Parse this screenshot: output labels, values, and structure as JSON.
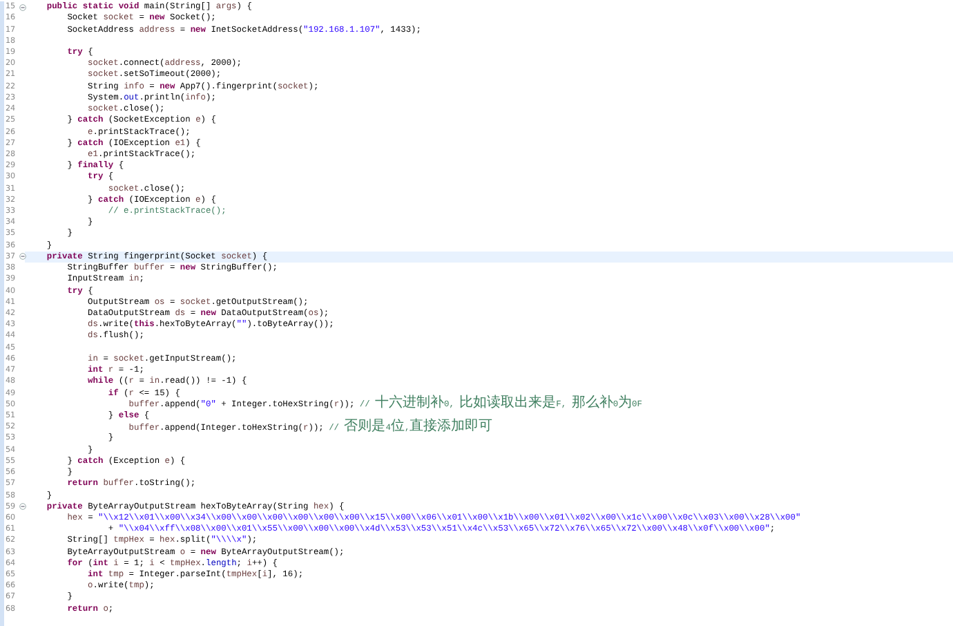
{
  "editor": {
    "lines": [
      {
        "number": "15",
        "fold": true,
        "current": false,
        "tokens": [
          {
            "kind": "keyword",
            "text": "    public static void"
          },
          {
            "kind": "plain",
            "text": " main(String[] "
          },
          {
            "kind": "variable",
            "text": "args"
          },
          {
            "kind": "plain",
            "text": ") {"
          }
        ]
      },
      {
        "number": "16",
        "fold": false,
        "current": false,
        "tokens": [
          {
            "kind": "plain",
            "text": "        Socket "
          },
          {
            "kind": "variable",
            "text": "socket"
          },
          {
            "kind": "plain",
            "text": " = "
          },
          {
            "kind": "keyword",
            "text": "new"
          },
          {
            "kind": "plain",
            "text": " Socket();"
          }
        ]
      },
      {
        "number": "17",
        "fold": false,
        "current": false,
        "tokens": [
          {
            "kind": "plain",
            "text": "        SocketAddress "
          },
          {
            "kind": "variable",
            "text": "address"
          },
          {
            "kind": "plain",
            "text": " = "
          },
          {
            "kind": "keyword",
            "text": "new"
          },
          {
            "kind": "plain",
            "text": " InetSocketAddress("
          },
          {
            "kind": "string",
            "text": "\"192.168.1.107\""
          },
          {
            "kind": "plain",
            "text": ", 1433);"
          }
        ]
      },
      {
        "number": "18",
        "fold": false,
        "current": false
      },
      {
        "number": "19",
        "fold": false,
        "current": false,
        "tokens": [
          {
            "kind": "keyword",
            "text": "        try"
          },
          {
            "kind": "plain",
            "text": " {"
          }
        ]
      },
      {
        "number": "20",
        "fold": false,
        "current": false,
        "tokens": [
          {
            "kind": "variable",
            "text": "            socket"
          },
          {
            "kind": "plain",
            "text": ".connect("
          },
          {
            "kind": "variable",
            "text": "address"
          },
          {
            "kind": "plain",
            "text": ", 2000);"
          }
        ]
      },
      {
        "number": "21",
        "fold": false,
        "current": false,
        "tokens": [
          {
            "kind": "variable",
            "text": "            socket"
          },
          {
            "kind": "plain",
            "text": ".setSoTimeout(2000);"
          }
        ]
      },
      {
        "number": "22",
        "fold": false,
        "current": false,
        "tokens": [
          {
            "kind": "plain",
            "text": "            String "
          },
          {
            "kind": "variable",
            "text": "info"
          },
          {
            "kind": "plain",
            "text": " = "
          },
          {
            "kind": "keyword",
            "text": "new"
          },
          {
            "kind": "plain",
            "text": " App7().fingerprint("
          },
          {
            "kind": "variable",
            "text": "socket"
          },
          {
            "kind": "plain",
            "text": ");"
          }
        ]
      },
      {
        "number": "23",
        "fold": false,
        "current": false,
        "tokens": [
          {
            "kind": "plain",
            "text": "            System."
          },
          {
            "kind": "field",
            "text": "out"
          },
          {
            "kind": "plain",
            "text": ".println("
          },
          {
            "kind": "variable",
            "text": "info"
          },
          {
            "kind": "plain",
            "text": ");"
          }
        ]
      },
      {
        "number": "24",
        "fold": false,
        "current": false,
        "tokens": [
          {
            "kind": "variable",
            "text": "            socket"
          },
          {
            "kind": "plain",
            "text": ".close();"
          }
        ]
      },
      {
        "number": "25",
        "fold": false,
        "current": false,
        "tokens": [
          {
            "kind": "plain",
            "text": "        } "
          },
          {
            "kind": "keyword",
            "text": "catch"
          },
          {
            "kind": "plain",
            "text": " (SocketException "
          },
          {
            "kind": "variable",
            "text": "e"
          },
          {
            "kind": "plain",
            "text": ") {"
          }
        ]
      },
      {
        "number": "26",
        "fold": false,
        "current": false,
        "tokens": [
          {
            "kind": "variable",
            "text": "            e"
          },
          {
            "kind": "plain",
            "text": ".printStackTrace();"
          }
        ]
      },
      {
        "number": "27",
        "fold": false,
        "current": false,
        "tokens": [
          {
            "kind": "plain",
            "text": "        } "
          },
          {
            "kind": "keyword",
            "text": "catch"
          },
          {
            "kind": "plain",
            "text": " (IOException "
          },
          {
            "kind": "variable",
            "text": "e1"
          },
          {
            "kind": "plain",
            "text": ") {"
          }
        ]
      },
      {
        "number": "28",
        "fold": false,
        "current": false,
        "tokens": [
          {
            "kind": "variable",
            "text": "            e1"
          },
          {
            "kind": "plain",
            "text": ".printStackTrace();"
          }
        ]
      },
      {
        "number": "29",
        "fold": false,
        "current": false,
        "tokens": [
          {
            "kind": "plain",
            "text": "        } "
          },
          {
            "kind": "keyword",
            "text": "finally"
          },
          {
            "kind": "plain",
            "text": " {"
          }
        ]
      },
      {
        "number": "30",
        "fold": false,
        "current": false,
        "tokens": [
          {
            "kind": "keyword",
            "text": "            try"
          },
          {
            "kind": "plain",
            "text": " {"
          }
        ]
      },
      {
        "number": "31",
        "fold": false,
        "current": false,
        "tokens": [
          {
            "kind": "variable",
            "text": "                socket"
          },
          {
            "kind": "plain",
            "text": ".close();"
          }
        ]
      },
      {
        "number": "32",
        "fold": false,
        "current": false,
        "tokens": [
          {
            "kind": "plain",
            "text": "            } "
          },
          {
            "kind": "keyword",
            "text": "catch"
          },
          {
            "kind": "plain",
            "text": " (IOException "
          },
          {
            "kind": "variable",
            "text": "e"
          },
          {
            "kind": "plain",
            "text": ") {"
          }
        ]
      },
      {
        "number": "33",
        "fold": false,
        "current": false,
        "tokens": [
          {
            "kind": "comment",
            "text": "                // e.printStackTrace();"
          }
        ]
      },
      {
        "number": "34",
        "fold": false,
        "current": false,
        "tokens": [
          {
            "kind": "plain",
            "text": "            }"
          }
        ]
      },
      {
        "number": "35",
        "fold": false,
        "current": false,
        "tokens": [
          {
            "kind": "plain",
            "text": "        }"
          }
        ]
      },
      {
        "number": "36",
        "fold": false,
        "current": false,
        "tokens": [
          {
            "kind": "plain",
            "text": "    }"
          }
        ]
      },
      {
        "number": "37",
        "fold": true,
        "current": true,
        "tokens": [
          {
            "kind": "keyword",
            "text": "    private"
          },
          {
            "kind": "plain",
            "text": " String fingerprint(Socket "
          },
          {
            "kind": "variable",
            "text": "socket"
          },
          {
            "kind": "plain",
            "text": ") {"
          }
        ]
      },
      {
        "number": "38",
        "fold": false,
        "current": false,
        "tokens": [
          {
            "kind": "plain",
            "text": "        StringBuffer "
          },
          {
            "kind": "variable",
            "text": "buffer"
          },
          {
            "kind": "plain",
            "text": " = "
          },
          {
            "kind": "keyword",
            "text": "new"
          },
          {
            "kind": "plain",
            "text": " StringBuffer();"
          }
        ]
      },
      {
        "number": "39",
        "fold": false,
        "current": false,
        "tokens": [
          {
            "kind": "plain",
            "text": "        InputStream "
          },
          {
            "kind": "variable",
            "text": "in"
          },
          {
            "kind": "plain",
            "text": ";"
          }
        ]
      },
      {
        "number": "40",
        "fold": false,
        "current": false,
        "tokens": [
          {
            "kind": "keyword",
            "text": "        try"
          },
          {
            "kind": "plain",
            "text": " {"
          }
        ]
      },
      {
        "number": "41",
        "fold": false,
        "current": false,
        "tokens": [
          {
            "kind": "plain",
            "text": "            OutputStream "
          },
          {
            "kind": "variable",
            "text": "os"
          },
          {
            "kind": "plain",
            "text": " = "
          },
          {
            "kind": "variable",
            "text": "socket"
          },
          {
            "kind": "plain",
            "text": ".getOutputStream();"
          }
        ]
      },
      {
        "number": "42",
        "fold": false,
        "current": false,
        "tokens": [
          {
            "kind": "plain",
            "text": "            DataOutputStream "
          },
          {
            "kind": "variable",
            "text": "ds"
          },
          {
            "kind": "plain",
            "text": " = "
          },
          {
            "kind": "keyword",
            "text": "new"
          },
          {
            "kind": "plain",
            "text": " DataOutputStream("
          },
          {
            "kind": "variable",
            "text": "os"
          },
          {
            "kind": "plain",
            "text": ");"
          }
        ]
      },
      {
        "number": "43",
        "fold": false,
        "current": false,
        "tokens": [
          {
            "kind": "variable",
            "text": "            ds"
          },
          {
            "kind": "plain",
            "text": ".write("
          },
          {
            "kind": "keyword",
            "text": "this"
          },
          {
            "kind": "plain",
            "text": ".hexToByteArray("
          },
          {
            "kind": "string",
            "text": "\"\""
          },
          {
            "kind": "plain",
            "text": ").toByteArray());"
          }
        ]
      },
      {
        "number": "44",
        "fold": false,
        "current": false,
        "tokens": [
          {
            "kind": "variable",
            "text": "            ds"
          },
          {
            "kind": "plain",
            "text": ".flush();"
          }
        ]
      },
      {
        "number": "45",
        "fold": false,
        "current": false
      },
      {
        "number": "46",
        "fold": false,
        "current": false,
        "tokens": [
          {
            "kind": "variable",
            "text": "            in"
          },
          {
            "kind": "plain",
            "text": " = "
          },
          {
            "kind": "variable",
            "text": "socket"
          },
          {
            "kind": "plain",
            "text": ".getInputStream();"
          }
        ]
      },
      {
        "number": "47",
        "fold": false,
        "current": false,
        "tokens": [
          {
            "kind": "keyword",
            "text": "            int"
          },
          {
            "kind": "variable",
            "text": " r"
          },
          {
            "kind": "plain",
            "text": " = -1;"
          }
        ]
      },
      {
        "number": "48",
        "fold": false,
        "current": false,
        "tokens": [
          {
            "kind": "keyword",
            "text": "            while"
          },
          {
            "kind": "plain",
            "text": " (("
          },
          {
            "kind": "variable",
            "text": "r"
          },
          {
            "kind": "plain",
            "text": " = "
          },
          {
            "kind": "variable",
            "text": "in"
          },
          {
            "kind": "plain",
            "text": ".read()) != -1) {"
          }
        ]
      },
      {
        "number": "49",
        "fold": false,
        "current": false,
        "tokens": [
          {
            "kind": "keyword",
            "text": "                if"
          },
          {
            "kind": "plain",
            "text": " ("
          },
          {
            "kind": "variable",
            "text": "r"
          },
          {
            "kind": "plain",
            "text": " <= 15) {"
          }
        ]
      },
      {
        "number": "50",
        "fold": false,
        "current": false,
        "tokens": [
          {
            "kind": "variable",
            "text": "                    buffer"
          },
          {
            "kind": "plain",
            "text": ".append("
          },
          {
            "kind": "string",
            "text": "\"0\""
          },
          {
            "kind": "plain",
            "text": " + Integer.toHexString("
          },
          {
            "kind": "variable",
            "text": "r"
          },
          {
            "kind": "plain",
            "text": "));"
          },
          {
            "kind": "comment",
            "text": " // 十六进制补0, 比如读取出来是F, 那么补0为0F"
          }
        ]
      },
      {
        "number": "51",
        "fold": false,
        "current": false,
        "tokens": [
          {
            "kind": "plain",
            "text": "                } "
          },
          {
            "kind": "keyword",
            "text": "else"
          },
          {
            "kind": "plain",
            "text": " {"
          }
        ]
      },
      {
        "number": "52",
        "fold": false,
        "current": false,
        "tokens": [
          {
            "kind": "variable",
            "text": "                    buffer"
          },
          {
            "kind": "plain",
            "text": ".append(Integer.toHexString("
          },
          {
            "kind": "variable",
            "text": "r"
          },
          {
            "kind": "plain",
            "text": "));"
          },
          {
            "kind": "comment",
            "text": " // 否则是4位,直接添加即可"
          }
        ]
      },
      {
        "number": "53",
        "fold": false,
        "current": false,
        "tokens": [
          {
            "kind": "plain",
            "text": "                }"
          }
        ]
      },
      {
        "number": "54",
        "fold": false,
        "current": false,
        "tokens": [
          {
            "kind": "plain",
            "text": "            }"
          }
        ]
      },
      {
        "number": "55",
        "fold": false,
        "current": false,
        "tokens": [
          {
            "kind": "plain",
            "text": "        } "
          },
          {
            "kind": "keyword",
            "text": "catch"
          },
          {
            "kind": "plain",
            "text": " (Exception "
          },
          {
            "kind": "variable",
            "text": "e"
          },
          {
            "kind": "plain",
            "text": ") {"
          }
        ]
      },
      {
        "number": "56",
        "fold": false,
        "current": false,
        "tokens": [
          {
            "kind": "plain",
            "text": "        }"
          }
        ]
      },
      {
        "number": "57",
        "fold": false,
        "current": false,
        "tokens": [
          {
            "kind": "keyword",
            "text": "        return"
          },
          {
            "kind": "variable",
            "text": " buffer"
          },
          {
            "kind": "plain",
            "text": ".toString();"
          }
        ]
      },
      {
        "number": "58",
        "fold": false,
        "current": false,
        "tokens": [
          {
            "kind": "plain",
            "text": "    }"
          }
        ]
      },
      {
        "number": "59",
        "fold": true,
        "current": false,
        "tokens": [
          {
            "kind": "keyword",
            "text": "    private"
          },
          {
            "kind": "plain",
            "text": " ByteArrayOutputStream hexToByteArray(String "
          },
          {
            "kind": "variable",
            "text": "hex"
          },
          {
            "kind": "plain",
            "text": ") {"
          }
        ]
      },
      {
        "number": "60",
        "fold": false,
        "current": false,
        "tokens": [
          {
            "kind": "variable",
            "text": "        hex"
          },
          {
            "kind": "plain",
            "text": " = "
          },
          {
            "kind": "string",
            "text": "\"\\\\x12\\\\x01\\\\x00\\\\x34\\\\x00\\\\x00\\\\x00\\\\x00\\\\x00\\\\x00\\\\x15\\\\x00\\\\x06\\\\x01\\\\x00\\\\x1b\\\\x00\\\\x01\\\\x02\\\\x00\\\\x1c\\\\x00\\\\x0c\\\\x03\\\\x00\\\\x28\\\\x00\""
          }
        ]
      },
      {
        "number": "61",
        "fold": false,
        "current": false,
        "tokens": [
          {
            "kind": "plain",
            "text": "                + "
          },
          {
            "kind": "string",
            "text": "\"\\\\x04\\\\xff\\\\x08\\\\x00\\\\x01\\\\x55\\\\x00\\\\x00\\\\x00\\\\x4d\\\\x53\\\\x53\\\\x51\\\\x4c\\\\x53\\\\x65\\\\x72\\\\x76\\\\x65\\\\x72\\\\x00\\\\x48\\\\x0f\\\\x00\\\\x00\""
          },
          {
            "kind": "plain",
            "text": ";"
          }
        ]
      },
      {
        "number": "62",
        "fold": false,
        "current": false,
        "tokens": [
          {
            "kind": "plain",
            "text": "        String[] "
          },
          {
            "kind": "variable",
            "text": "tmpHex"
          },
          {
            "kind": "plain",
            "text": " = "
          },
          {
            "kind": "variable",
            "text": "hex"
          },
          {
            "kind": "plain",
            "text": ".split("
          },
          {
            "kind": "string",
            "text": "\"\\\\\\\\x\""
          },
          {
            "kind": "plain",
            "text": ");"
          }
        ]
      },
      {
        "number": "63",
        "fold": false,
        "current": false,
        "tokens": [
          {
            "kind": "plain",
            "text": "        ByteArrayOutputStream "
          },
          {
            "kind": "variable",
            "text": "o"
          },
          {
            "kind": "plain",
            "text": " = "
          },
          {
            "kind": "keyword",
            "text": "new"
          },
          {
            "kind": "plain",
            "text": " ByteArrayOutputStream();"
          }
        ]
      },
      {
        "number": "64",
        "fold": false,
        "current": false,
        "tokens": [
          {
            "kind": "keyword",
            "text": "        for"
          },
          {
            "kind": "plain",
            "text": " ("
          },
          {
            "kind": "keyword",
            "text": "int"
          },
          {
            "kind": "variable",
            "text": " i"
          },
          {
            "kind": "plain",
            "text": " = 1; "
          },
          {
            "kind": "variable",
            "text": "i"
          },
          {
            "kind": "plain",
            "text": " < "
          },
          {
            "kind": "variable",
            "text": "tmpHex"
          },
          {
            "kind": "plain",
            "text": "."
          },
          {
            "kind": "field",
            "text": "length"
          },
          {
            "kind": "plain",
            "text": "; "
          },
          {
            "kind": "variable",
            "text": "i"
          },
          {
            "kind": "plain",
            "text": "++) {"
          }
        ]
      },
      {
        "number": "65",
        "fold": false,
        "current": false,
        "tokens": [
          {
            "kind": "keyword",
            "text": "            int"
          },
          {
            "kind": "variable",
            "text": " tmp"
          },
          {
            "kind": "plain",
            "text": " = Integer.parseInt("
          },
          {
            "kind": "variable",
            "text": "tmpHex"
          },
          {
            "kind": "plain",
            "text": "["
          },
          {
            "kind": "variable",
            "text": "i"
          },
          {
            "kind": "plain",
            "text": "], 16);"
          }
        ]
      },
      {
        "number": "66",
        "fold": false,
        "current": false,
        "tokens": [
          {
            "kind": "variable",
            "text": "            o"
          },
          {
            "kind": "plain",
            "text": ".write("
          },
          {
            "kind": "variable",
            "text": "tmp"
          },
          {
            "kind": "plain",
            "text": ");"
          }
        ]
      },
      {
        "number": "67",
        "fold": false,
        "current": false,
        "tokens": [
          {
            "kind": "plain",
            "text": "        }"
          }
        ]
      },
      {
        "number": "68",
        "fold": false,
        "current": false,
        "tokens": [
          {
            "kind": "keyword",
            "text": "        return"
          },
          {
            "kind": "variable",
            "text": " o"
          },
          {
            "kind": "plain",
            "text": ";"
          }
        ]
      }
    ]
  }
}
